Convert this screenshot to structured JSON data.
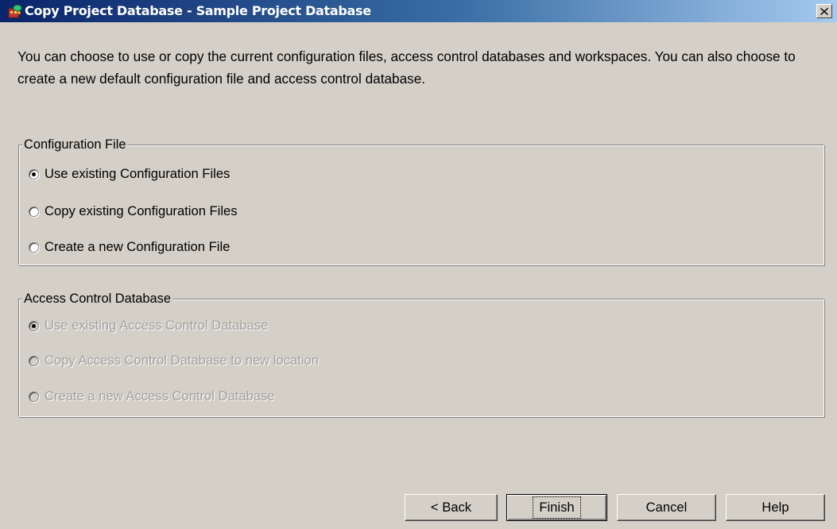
{
  "window": {
    "title": "Copy Project Database - Sample Project Database",
    "app_icon": "database-app-icon",
    "close_label": "×"
  },
  "intro_text": "You can choose to use or copy the current configuration files, access control databases and workspaces.  You can also choose to create a new default configuration file and access control database.",
  "configuration_group": {
    "legend": "Configuration File",
    "enabled": true,
    "options": [
      {
        "label": "Use existing Configuration Files",
        "selected": true
      },
      {
        "label": "Copy existing Configuration Files",
        "selected": false
      },
      {
        "label": "Create a new Configuration File",
        "selected": false
      }
    ]
  },
  "access_control_group": {
    "legend": "Access Control Database",
    "enabled": false,
    "options": [
      {
        "label": "Use existing Access Control Database",
        "selected": true
      },
      {
        "label": "Copy Access Control Database to new location",
        "selected": false
      },
      {
        "label": "Create a new Access Control Database",
        "selected": false
      }
    ]
  },
  "buttons": {
    "back": "< Back",
    "finish": "Finish",
    "cancel": "Cancel",
    "help": "Help"
  },
  "colors": {
    "dialog_bg": "#d4d0c8",
    "titlebar_start": "#0a246a",
    "titlebar_end": "#a6caf0",
    "disabled_text": "#a0a0a0"
  }
}
